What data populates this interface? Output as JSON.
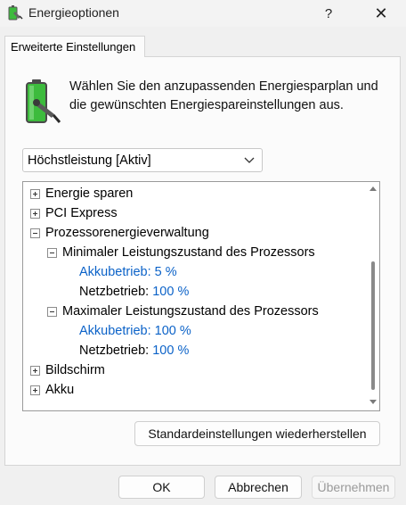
{
  "window": {
    "title": "Energieoptionen",
    "help_label": "?",
    "close_label": "✕"
  },
  "tab": {
    "label": "Erweiterte Einstellungen"
  },
  "description": "Wählen Sie den anzupassenden Energiesparplan und die gewünschten Energiespareinstellungen aus.",
  "plan_select": {
    "value": "Höchstleistung [Aktiv]"
  },
  "tree": {
    "energie_sparen": "Energie sparen",
    "pci_express": "PCI Express",
    "prozessor": "Prozessorenergieverwaltung",
    "min_state": "Minimaler Leistungszustand des Prozessors",
    "min_akku_label": "Akkubetrieb:",
    "min_akku_value": "5 %",
    "min_netz_label": "Netzbetrieb:",
    "min_netz_value": "100 %",
    "max_state": "Maximaler Leistungszustand des Prozessors",
    "max_akku_label": "Akkubetrieb:",
    "max_akku_value": "100 %",
    "max_netz_label": "Netzbetrieb:",
    "max_netz_value": "100 %",
    "bildschirm": "Bildschirm",
    "akku": "Akku"
  },
  "buttons": {
    "restore": "Standardeinstellungen wiederherstellen",
    "ok": "OK",
    "cancel": "Abbrechen",
    "apply": "Übernehmen"
  },
  "colors": {
    "accent_blue": "#0b62c8",
    "battery_green": "#3dbb3d"
  }
}
